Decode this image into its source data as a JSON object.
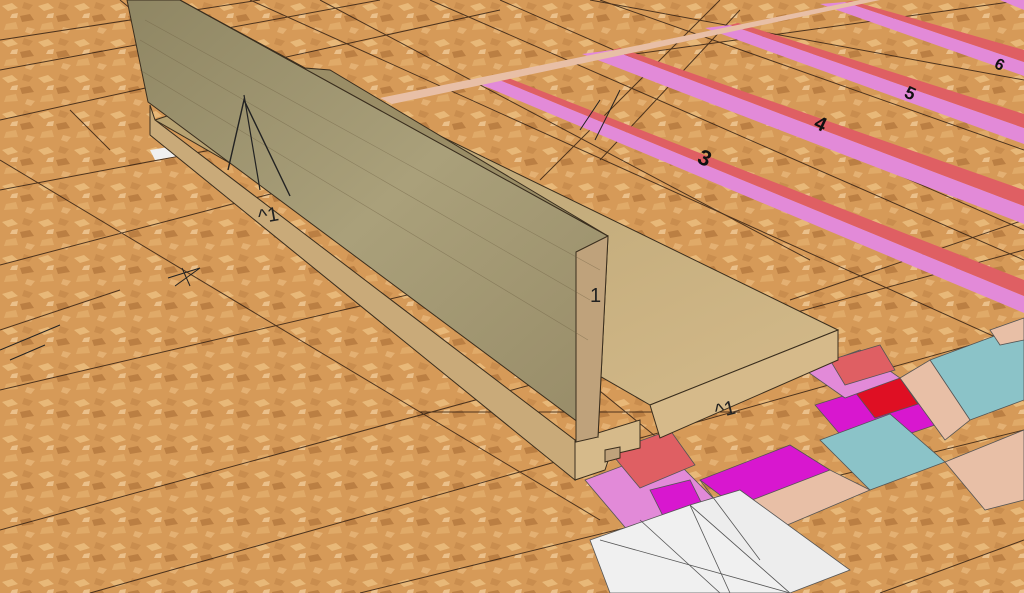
{
  "scene": {
    "description_free": true,
    "colors": {
      "board": "#d69a58",
      "board_light": "#e8b878",
      "board_dark": "#bb7f43",
      "grid_line": "#2b1a0f",
      "strip_red": "#df5f63",
      "strip_pink": "#e28ad8",
      "strip_magenta": "#d817cf",
      "tile_teal": "#8bc3c8",
      "tile_peach": "#e8bfa6",
      "tile_white": "#f0f0f0",
      "wood_face": "#a89d73",
      "wood_top": "#9a8d66",
      "wood_end": "#bfa27b",
      "wood_base": "#d6ba8a",
      "wood_base_top": "#c9aa79",
      "wood_dark": "#6d5f42"
    },
    "labels": {
      "strip_1": "3",
      "strip_2": "4",
      "strip_3": "5",
      "strip_4": "6",
      "wall_mark": "^1",
      "base_mark": "^1",
      "end_mark": "1"
    }
  }
}
